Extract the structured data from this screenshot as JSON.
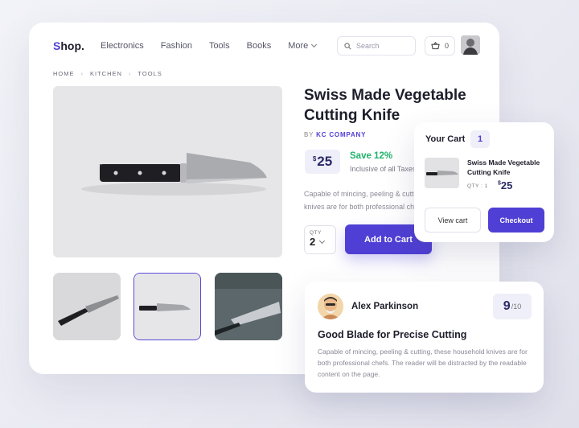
{
  "header": {
    "logo_mark": "S",
    "logo_rest": "hop.",
    "nav": [
      "Electronics",
      "Fashion",
      "Tools",
      "Books",
      "More"
    ],
    "search_placeholder": "Search",
    "cart_count": "0"
  },
  "breadcrumb": [
    "HOME",
    "KITCHEN",
    "TOOLS"
  ],
  "product": {
    "title": "Swiss Made Vegetable Cutting Knife",
    "by_label": "BY",
    "brand": "KC COMPANY",
    "currency": "$",
    "price": "25",
    "save": "Save 12%",
    "tax_note": "Inclusive of all Taxes",
    "desc_line1": "Capable of mincing, peeling & cutting, these",
    "desc_line2": "knives are for both professional chefs.",
    "qty_label": "QTY",
    "qty_value": "2",
    "add_to_cart": "Add to Cart"
  },
  "cart": {
    "title": "Your Cart",
    "count": "1",
    "item_name": "Swiss Made Vegetable Cutting Knife",
    "item_qty": "QTY : 1",
    "currency": "$",
    "item_price": "25",
    "view_cart": "View cart",
    "checkout": "Checkout"
  },
  "review": {
    "name": "Alex Parkinson",
    "score": "9",
    "score_max": "/10",
    "headline": "Good Blade for Precise Cutting",
    "body": "Capable of mincing, peeling & cutting, these household knives are for both professional chefs. The reader will be distracted by the readable content on the page."
  },
  "colors": {
    "accent": "#4f3fd4",
    "save_green": "#20b36a",
    "badge_bg": "#efeffa"
  }
}
